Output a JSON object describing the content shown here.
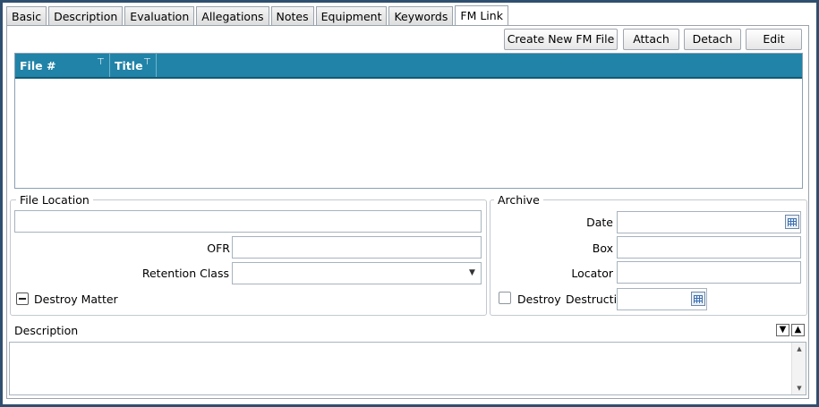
{
  "tabs": [
    {
      "label": "Basic"
    },
    {
      "label": "Description"
    },
    {
      "label": "Evaluation"
    },
    {
      "label": "Allegations"
    },
    {
      "label": "Notes"
    },
    {
      "label": "Equipment"
    },
    {
      "label": "Keywords"
    },
    {
      "label": "FM Link",
      "active": true
    }
  ],
  "toolbar": {
    "create_label": "Create New FM File",
    "attach_label": "Attach",
    "detach_label": "Detach",
    "edit_label": "Edit"
  },
  "grid": {
    "columns": [
      "File #",
      "Title"
    ],
    "rows": []
  },
  "file_location": {
    "legend": "File Location",
    "location_value": "",
    "ofr_label": "OFR",
    "ofr_value": "",
    "retention_label": "Retention Class",
    "retention_value": "",
    "destroy_matter_label": "Destroy Matter"
  },
  "archive": {
    "legend": "Archive",
    "date_label": "Date",
    "date_value": "",
    "box_label": "Box",
    "box_value": "",
    "locator_label": "Locator",
    "locator_value": "",
    "destroy_label": "Destroy",
    "destruction_label": "Destructio",
    "destruction_value": ""
  },
  "description": {
    "label": "Description",
    "value": ""
  },
  "colors": {
    "frame_border": "#2f4f6f",
    "grid_header": "#2183a7",
    "accent": "#135a75"
  },
  "icons": {
    "filter": "filter-icon",
    "calendar": "calendar-icon",
    "dropdown": "chevron-down-icon",
    "collapse": "minus-icon",
    "move_down": "triangle-down-icon",
    "move_up": "triangle-up-icon"
  }
}
